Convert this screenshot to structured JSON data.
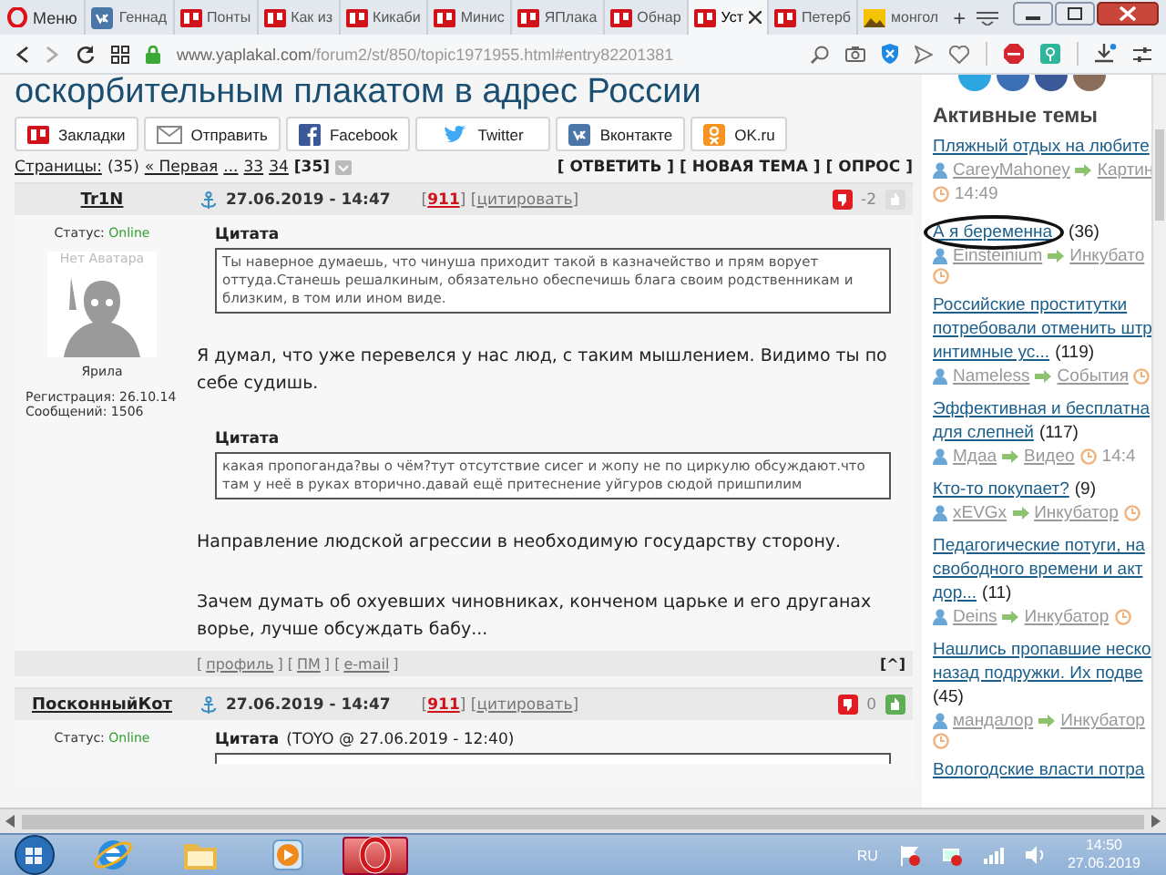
{
  "browser": {
    "menu": "Меню",
    "tabs": [
      {
        "kind": "vk",
        "label": "Геннад",
        "selected": false
      },
      {
        "kind": "yp",
        "label": "Понты",
        "selected": false
      },
      {
        "kind": "yp",
        "label": "Как из",
        "selected": false
      },
      {
        "kind": "yp",
        "label": "Кикаби",
        "selected": false
      },
      {
        "kind": "yp",
        "label": "Минис",
        "selected": false
      },
      {
        "kind": "yp",
        "label": "ЯПлака",
        "selected": false
      },
      {
        "kind": "yp",
        "label": "Обнар",
        "selected": false
      },
      {
        "kind": "yp",
        "label": "Уст",
        "selected": true
      },
      {
        "kind": "yp",
        "label": "Петерб",
        "selected": false
      },
      {
        "kind": "image",
        "label": "монгол",
        "selected": false
      }
    ],
    "new_tab": "+",
    "url": {
      "host": "www.yaplakal.com",
      "path": "/forum2/st/850/topic1971955.html#entry82201381"
    }
  },
  "topic_title": "оскорбительным плакатом в адрес России",
  "share_buttons": [
    {
      "kind": "yp",
      "label": "Закладки"
    },
    {
      "kind": "mail",
      "label": "Отправить"
    },
    {
      "kind": "facebook",
      "label": "Facebook"
    },
    {
      "kind": "twitter",
      "label": "Twitter"
    },
    {
      "kind": "vk",
      "label": "Вконтакте"
    },
    {
      "kind": "ok",
      "label": "OK.ru"
    }
  ],
  "pagination": {
    "label": "Страницы:",
    "count": "(35)",
    "links": [
      "« Первая",
      "...",
      "33",
      "34"
    ],
    "current": "[35]"
  },
  "actions": [
    "[ ОТВЕТИТЬ ]",
    "[ НОВАЯ ТЕМА ]",
    "[ ОПРОС ]"
  ],
  "posts": [
    {
      "author": "Tr1N",
      "date": "27.06.2019 - 14:47",
      "header_brackets": [
        "[",
        "] [",
        "]"
      ],
      "footer_brackets": [
        "[",
        "] [",
        "] [",
        "]"
      ],
      "rating": "911",
      "quote_link": "цитировать",
      "votes": "-2",
      "status_label": "Статус:",
      "status": "Online",
      "avatar_label": "Нет Аватара",
      "rank": "Ярила",
      "registration": "Регистрация: 26.10.14",
      "messages": "Сообщений: 1506",
      "body": [
        {
          "kind": "quote",
          "title": "Цитата",
          "text": "Ты наверное думаешь, что чинуша приходит такой в казначейство и прям ворует оттуда.Станешь решалкиным, обязательно обеспечишь блага своим родственникам и близким, в том или ином виде."
        },
        {
          "kind": "text",
          "text": "Я думал, что уже перевелся у нас люд, с таким мышлением. Видимо ты по себе судишь."
        },
        {
          "kind": "quote",
          "title": "Цитата",
          "text": "какая пропоганда?вы о чём?тут отсутствие сисег и жопу не по циркулю обсуждают.что там у неё в руках вторично.давай ещё притеснение уйгуров сюдой пришпилим"
        },
        {
          "kind": "text",
          "text": "Направление людской агрессии в необходимую государству сторону."
        },
        {
          "kind": "text",
          "text": "Зачем думать об охуевших чиновниках, конченом царьке и его друганах ворье, лучше обсуждать бабу..."
        }
      ],
      "footer_links": [
        "профиль",
        "ПМ",
        "e-mail"
      ],
      "top": "[^]"
    },
    {
      "author": "ПосконныйКот",
      "date": "27.06.2019 - 14:47",
      "header_brackets": [
        "[",
        "] [",
        "]"
      ],
      "rating": "911",
      "quote_link": "цитировать",
      "votes": "0",
      "status_label": "Статус:",
      "status": "Online",
      "body": [
        {
          "kind": "quote",
          "title": "Цитата",
          "source": "(TOYO @ 27.06.2019 - 12:40)"
        }
      ]
    }
  ],
  "sidebar": {
    "heading": "Активные темы",
    "topics": [
      {
        "lines": [
          "Пляжный отдых на любите"
        ],
        "author": "CareyMahoney",
        "section": "Картин",
        "time": "14:49"
      },
      {
        "lines": [
          "А я беременна"
        ],
        "count": "(36)",
        "author": "Einsteinium",
        "section": "Инкубато",
        "circled": true
      },
      {
        "lines": [
          "Российские проститутки",
          "потребовали отменить штр",
          "интимные ус..."
        ],
        "count": "(119)",
        "author": "Nameless",
        "section": "События"
      },
      {
        "lines": [
          "Эффективная и бесплатна",
          "для слепней"
        ],
        "count": "(117)",
        "author": "Мдаа",
        "section": "Видео",
        "time": "14:4"
      },
      {
        "lines": [
          "Кто-то покупает?"
        ],
        "count": "(9)",
        "author": "xEVGx",
        "section": "Инкубатор"
      },
      {
        "lines": [
          "Педагогические потуги, на",
          "свободного времени и акт",
          "дор..."
        ],
        "count": "(11)",
        "author": "Deins",
        "section": "Инкубатор"
      },
      {
        "lines": [
          "Нашлись пропавшие неско",
          "назад подружки. Их подве"
        ],
        "count": "(45)",
        "author": "мандалор",
        "section": "Инкубатор"
      },
      {
        "lines": [
          "Вологодские власти потра"
        ]
      }
    ]
  },
  "taskbar": {
    "apps": [
      {
        "kind": "ie",
        "selected": false
      },
      {
        "kind": "folder",
        "selected": false
      },
      {
        "kind": "media",
        "selected": false
      },
      {
        "kind": "opera",
        "selected": true
      }
    ],
    "language": "RU",
    "time": "14:50",
    "date": "27.06.2019"
  }
}
